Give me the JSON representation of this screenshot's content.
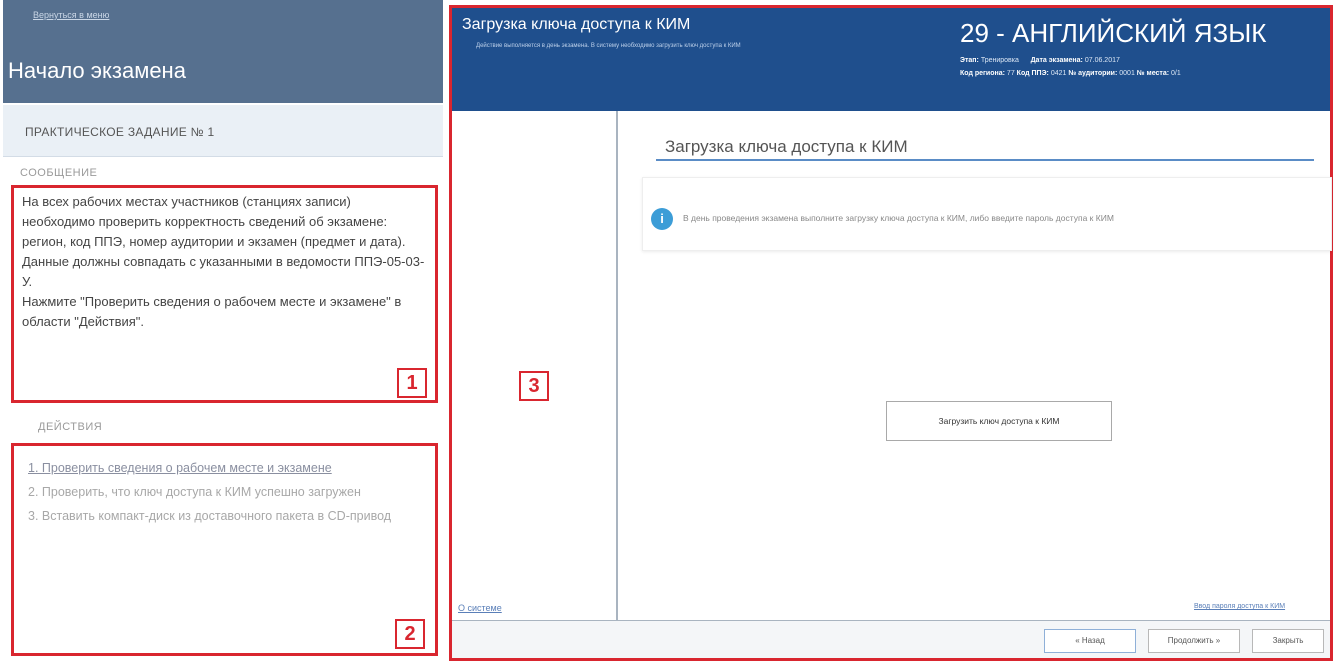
{
  "left": {
    "back_link": "Вернуться в меню",
    "title": "Начало экзамена",
    "task_title": "ПРАКТИЧЕСКОЕ ЗАДАНИЕ № 1",
    "message_label": "СООБЩЕНИЕ",
    "message_text": "На всех рабочих местах участников (станциях записи) необходимо проверить корректность сведений об экзамене: регион, код ППЭ, номер аудитории и экзамен (предмет и дата).\nДанные должны совпадать с указанными в ведомости ППЭ-05-03-У.\nНажмите \"Проверить сведения о рабочем месте и экзамене\" в области \"Действия\".",
    "actions_label": "ДЕЙСТВИЯ",
    "actions": [
      "1. Проверить сведения о рабочем месте и экзамене",
      "2. Проверить, что ключ доступа к КИМ успешно загружен",
      "3. Вставить компакт-диск из доставочного пакета в CD-привод"
    ],
    "badge_1": "1",
    "badge_2": "2"
  },
  "right": {
    "header_title": "Загрузка ключа доступа к КИМ",
    "header_sub": "Действие выполняется в день экзамена. В систему необходимо загрузить ключ доступа к КИМ",
    "subject": "29 - АНГЛИЙСКИЙ ЯЗЫК",
    "info": {
      "stage_label": "Этап:",
      "stage_value": "Тренировка",
      "date_label": "Дата экзамена:",
      "date_value": "07.06.2017",
      "region_label": "Код региона:",
      "region_value": "77",
      "ppe_label": "Код ППЭ:",
      "ppe_value": "0421",
      "aud_label": "№ аудитории:",
      "aud_value": "0001",
      "place_label": "№ места:",
      "place_value": "0/1"
    },
    "side_link": "О системе",
    "content_title": "Загрузка ключа доступа к КИМ",
    "hint_icon": "i",
    "hint_text": "В день проведения экзамена выполните загрузку ключа доступа к КИМ, либо введите пароль доступа к КИМ",
    "load_button": "Загрузить ключ доступа к КИМ",
    "enter_password_link": "Ввод пароля доступа к КИМ",
    "badge_3": "3",
    "buttons": {
      "back": "« Назад",
      "next": "Продолжить »",
      "close": "Закрыть"
    }
  },
  "colors": {
    "accent_red": "#d9262f",
    "left_header": "#56708f",
    "right_header": "#1f4f8d",
    "hint_icon": "#3c9dd7"
  }
}
